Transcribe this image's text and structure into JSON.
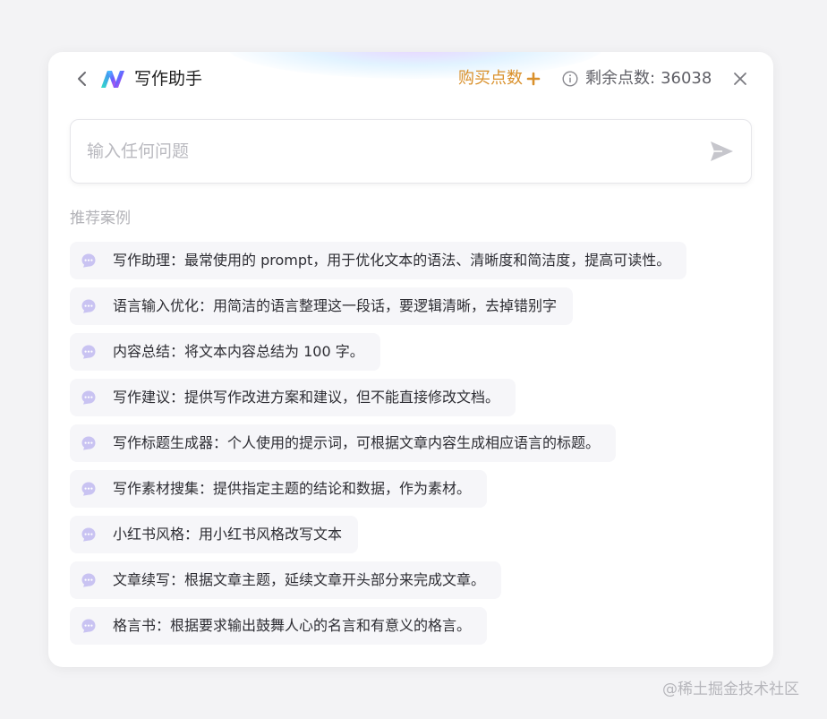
{
  "header": {
    "title": "写作助手",
    "buy_label": "购买点数",
    "points_label": "剩余点数:",
    "points_value": "36038"
  },
  "search": {
    "placeholder": "输入任何问题",
    "value": ""
  },
  "section_title": "推荐案例",
  "examples": [
    "写作助理：最常使用的 prompt，用于优化文本的语法、清晰度和简洁度，提高可读性。",
    "语言输入优化：用简洁的语言整理这一段话，要逻辑清晰，去掉错别字",
    "内容总结：将文本内容总结为 100 字。",
    "写作建议：提供写作改进方案和建议，但不能直接修改文档。",
    "写作标题生成器：个人使用的提示词，可根据文章内容生成相应语言的标题。",
    "写作素材搜集：提供指定主题的结论和数据，作为素材。",
    "小红书风格：用小红书风格改写文本",
    "文章续写：根据文章主题，延续文章开头部分来完成文章。",
    "格言书：根据要求输出鼓舞人心的名言和有意义的格言。"
  ],
  "watermark": "@稀土掘金技术社区",
  "icons": {
    "back": "chevron-left-icon",
    "logo": "app-logo-icon",
    "plus": "plus-icon",
    "info": "info-icon",
    "close": "close-icon",
    "send": "send-icon",
    "chat": "chat-bubble-icon"
  },
  "colors": {
    "accent_orange": "#d9902b",
    "chat_icon": "#c9c3f2",
    "item_bg": "#f6f6f9",
    "send_icon": "#c6c6cc"
  }
}
